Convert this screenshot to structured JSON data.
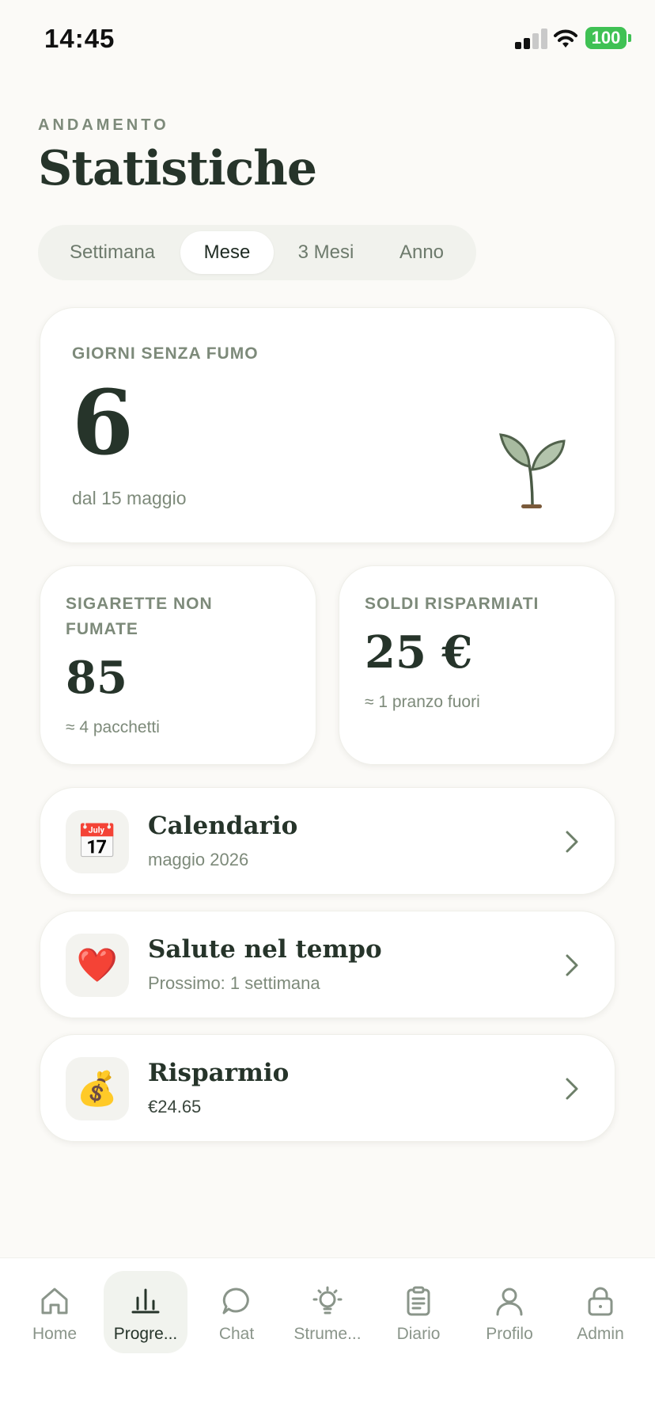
{
  "status_bar": {
    "time": "14:45",
    "battery": "100"
  },
  "header": {
    "eyebrow": "ANDAMENTO",
    "title": "Statistiche"
  },
  "segments": [
    {
      "label": "Settimana",
      "active": false
    },
    {
      "label": "Mese",
      "active": true
    },
    {
      "label": "3 Mesi",
      "active": false
    },
    {
      "label": "Anno",
      "active": false
    }
  ],
  "smoke_free": {
    "label": "GIORNI SENZA FUMO",
    "value": "6",
    "since": "dal 15 maggio",
    "icon": "sprout-icon"
  },
  "cigarettes": {
    "label": "SIGARETTE NON FUMATE",
    "value": "85",
    "sub": "≈ 4 pacchetti"
  },
  "money": {
    "label": "SOLDI RISPARMIATI",
    "value": "25 €",
    "sub": "≈ 1 pranzo fuori"
  },
  "list": [
    {
      "icon": "calendar-icon",
      "glyph": "📅",
      "title": "Calendario",
      "subtitle": "maggio 2026"
    },
    {
      "icon": "heart-icon",
      "glyph": "❤️",
      "title": "Salute nel tempo",
      "subtitle": "Prossimo: 1 settimana"
    },
    {
      "icon": "money-bag-icon",
      "glyph": "💰",
      "title": "Risparmio",
      "subtitle": "€24.65"
    }
  ],
  "tabs": [
    {
      "label": "Home",
      "icon": "home-icon",
      "active": false
    },
    {
      "label": "Progre...",
      "icon": "chart-icon",
      "active": true
    },
    {
      "label": "Chat",
      "icon": "chat-icon",
      "active": false
    },
    {
      "label": "Strume...",
      "icon": "lightbulb-icon",
      "active": false
    },
    {
      "label": "Diario",
      "icon": "clipboard-icon",
      "active": false
    },
    {
      "label": "Profilo",
      "icon": "user-icon",
      "active": false
    },
    {
      "label": "Admin",
      "icon": "lock-icon",
      "active": false
    }
  ],
  "colors": {
    "accent": "#26342a",
    "muted": "#7d8a7a",
    "background": "#fbfaf7",
    "battery": "#3fc154"
  }
}
